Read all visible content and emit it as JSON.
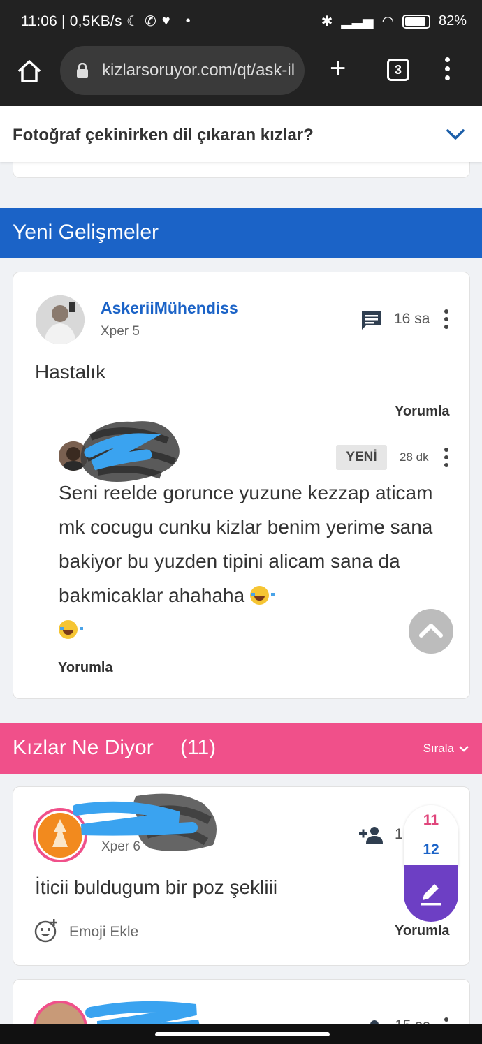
{
  "status_bar": {
    "time": "11:06 | 0,5KB/s",
    "battery": "82%"
  },
  "browser": {
    "url": "kizlarsoruyor.com/qt/ask-il",
    "tab_count": "3"
  },
  "question": {
    "title": "Fotoğraf çekinirken dil çıkaran kızlar?"
  },
  "sections": {
    "updates_title": "Yeni Gelişmeler",
    "girls_title": "Kızlar Ne Diyor",
    "girls_count": "(11)",
    "sort_label": "Sırala"
  },
  "update_post": {
    "username": "AskeriiMühendiss",
    "xper": "Xper 5",
    "time": "16 sa",
    "text": "Hastalık",
    "comment_label": "Yorumla"
  },
  "reply": {
    "badge": "YENİ",
    "time": "28 dk",
    "text": "Seni reelde gorunce yuzune kezzap aticam mk cocugu cunku kizlar benim yerime sana bakiyor bu yuzden tipini alicam sana da bakmicaklar ahahaha",
    "comment_label": "Yorumla"
  },
  "girl_post": {
    "xper": "Xper 6",
    "time": "1",
    "text": "İticii buldugum bir poz şekliii",
    "emoji_label": "Emoji Ekle",
    "comment_label": "Yorumla"
  },
  "vote_counter": {
    "girls": "11",
    "boys": "12"
  },
  "next_post": {
    "time": "15 sa"
  }
}
